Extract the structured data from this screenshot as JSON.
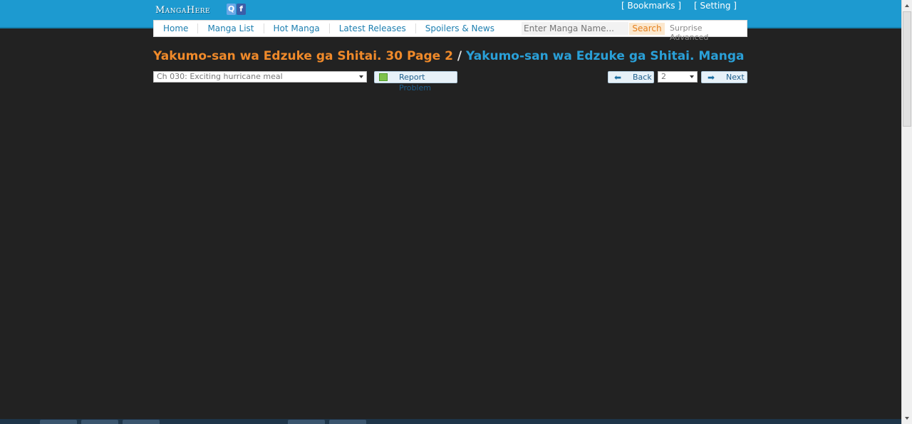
{
  "header": {
    "logo_text": "MangaHere",
    "social": [
      {
        "name": "qq-icon",
        "glyph": "Q",
        "color": "#6aa8e8"
      },
      {
        "name": "facebook-icon",
        "glyph": "f",
        "color": "#3b5ea8"
      }
    ],
    "links": [
      "[ Bookmarks ]",
      "[ Setting ]"
    ]
  },
  "nav": {
    "items": [
      "Home",
      "Manga List",
      "Hot Manga",
      "Latest Releases",
      "Spoilers & News"
    ],
    "search_placeholder": "Enter Manga Name...",
    "search_button": "Search",
    "extra": [
      "Surprise",
      "Advanced"
    ]
  },
  "title": {
    "chapter_page": "Yakumo-san wa Edzuke ga Shitai. 30 Page 2",
    "separator": "/",
    "manga_link": "Yakumo-san wa Edzuke ga Shitai. Manga"
  },
  "controls": {
    "chapter_selected": "Ch 030: Exciting hurricane meal",
    "report_label": "Report Problem",
    "back_label": "Back",
    "page_selected": "2",
    "next_label": "Next"
  },
  "colors": {
    "topbar": "#1d9ad0",
    "background": "#222222",
    "title_orange": "#f08a2a",
    "title_blue": "#2aa0d8"
  }
}
